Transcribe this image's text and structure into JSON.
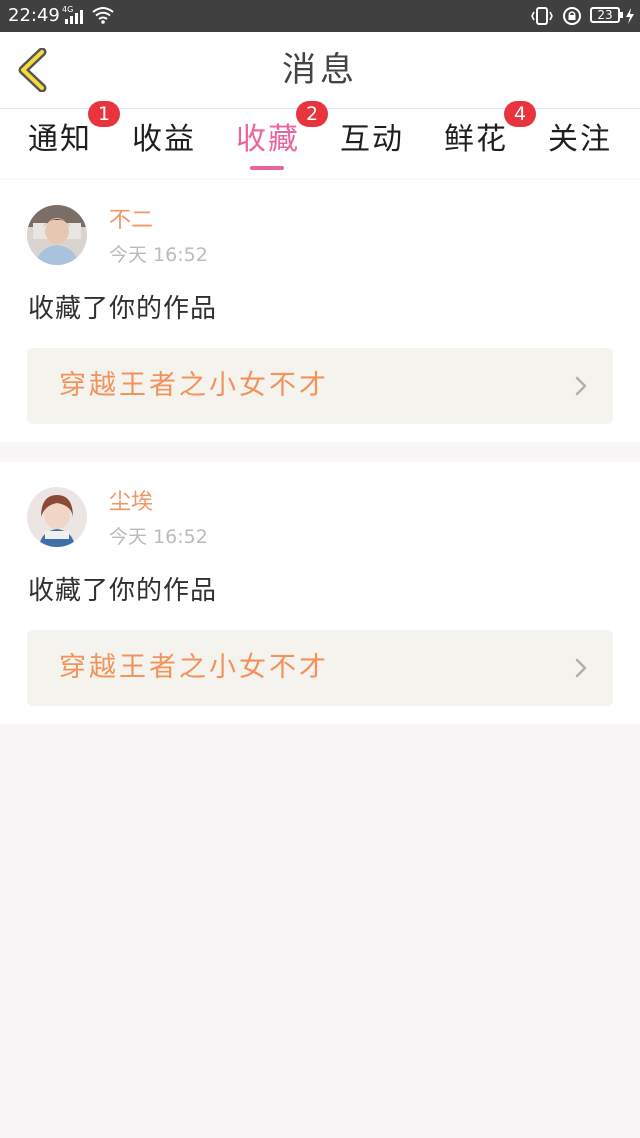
{
  "status": {
    "time": "22:49",
    "network": "4G",
    "battery": "23"
  },
  "header": {
    "title": "消息"
  },
  "tabs": [
    {
      "label": "通知",
      "badge": "1"
    },
    {
      "label": "收益",
      "badge": ""
    },
    {
      "label": "收藏",
      "badge": "2",
      "active": true
    },
    {
      "label": "互动",
      "badge": ""
    },
    {
      "label": "鲜花",
      "badge": "4"
    },
    {
      "label": "关注",
      "badge": ""
    }
  ],
  "colors": {
    "accent": "#e9669c",
    "badge": "#e8343e",
    "username": "#f19764",
    "work_title": "#f2935c"
  },
  "items": [
    {
      "user": "不二",
      "time": "今天 16:52",
      "message": "收藏了你的作品",
      "work_title": "穿越王者之小女不才"
    },
    {
      "user": "尘埃",
      "time": "今天 16:52",
      "message": "收藏了你的作品",
      "work_title": "穿越王者之小女不才"
    }
  ]
}
